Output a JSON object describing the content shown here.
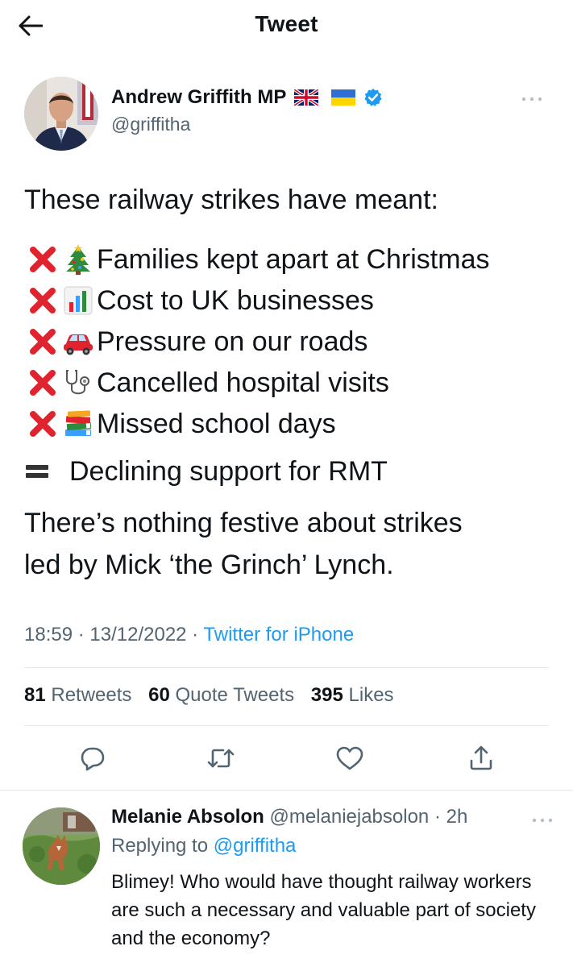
{
  "header": {
    "title": "Tweet",
    "back_icon": "arrow-left-icon"
  },
  "author": {
    "name": "Andrew Griffith MP",
    "handle": "@griffitha",
    "flags": [
      "uk-flag-icon",
      "ukraine-flag-icon"
    ],
    "verified": true
  },
  "tweet": {
    "intro": "These railway strikes have meant:",
    "items": [
      {
        "icons": [
          "cross-mark-icon",
          "christmas-tree-icon"
        ],
        "text": "Families kept apart at Christmas"
      },
      {
        "icons": [
          "cross-mark-icon",
          "bar-chart-icon"
        ],
        "text": "Cost to UK businesses"
      },
      {
        "icons": [
          "cross-mark-icon",
          "car-icon"
        ],
        "text": "Pressure on our roads"
      },
      {
        "icons": [
          "cross-mark-icon",
          "stethoscope-icon"
        ],
        "text": "Cancelled hospital visits"
      },
      {
        "icons": [
          "cross-mark-icon",
          "books-icon"
        ],
        "text": "Missed school days"
      }
    ],
    "conclusion_icon": "equals-icon",
    "conclusion": "Declining support for RMT",
    "closing_line1": "There’s nothing festive about strikes",
    "closing_line2": "led by Mick ‘the Grinch’ Lynch."
  },
  "meta": {
    "time": "18:59",
    "date": "13/12/2022",
    "separator": " · ",
    "source": "Twitter for iPhone"
  },
  "stats": {
    "retweets_count": "81",
    "retweets_label": "Retweets",
    "quotes_count": "60",
    "quotes_label": "Quote Tweets",
    "likes_count": "395",
    "likes_label": "Likes"
  },
  "actions": [
    "reply-icon",
    "retweet-icon",
    "like-icon",
    "share-icon"
  ],
  "reply": {
    "name": "Melanie Absolon",
    "handle": "@melaniejabsolon",
    "time": "2h",
    "replying_prefix": "Replying to",
    "replying_to": "@griffitha",
    "text": "Blimey! Who would have thought railway workers are such a necessary and valuable part of society and the economy?"
  },
  "colors": {
    "accent": "#1d9bf0",
    "muted": "#536471",
    "text": "#0f1419",
    "cross": "#e0242f"
  }
}
